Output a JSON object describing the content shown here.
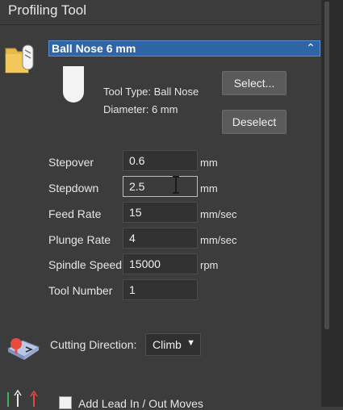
{
  "panel": {
    "title": "Profiling Tool"
  },
  "tool": {
    "name": "Ball Nose 6 mm",
    "type_text": "Tool Type: Ball Nose",
    "diameter_text": "Diameter:  6 mm",
    "select_label": "Select...",
    "deselect_label": "Deselect"
  },
  "params": {
    "stepover": {
      "label": "Stepover",
      "value": "0.6",
      "unit": "mm"
    },
    "stepdown": {
      "label": "Stepdown",
      "value": "2.5",
      "unit": "mm"
    },
    "feed_rate": {
      "label": "Feed Rate",
      "value": "15",
      "unit": "mm/sec"
    },
    "plunge_rate": {
      "label": "Plunge Rate",
      "value": "4",
      "unit": "mm/sec"
    },
    "spindle_speed": {
      "label": "Spindle Speed",
      "value": "15000",
      "unit": "rpm"
    },
    "tool_number": {
      "label": "Tool Number",
      "value": "1"
    }
  },
  "cutting": {
    "label": "Cutting Direction:",
    "selected": "Climb"
  },
  "lead": {
    "label": "Add Lead In / Out Moves"
  },
  "colors": {
    "header_bg": "#2f64a6",
    "panel_bg": "#3c3c3c"
  },
  "icons": [
    "folder-tool-icon",
    "ball-nose-icon",
    "collapse-chevron-icon",
    "cutting-direction-icon",
    "lead-moves-icon",
    "dropdown-arrow-icon"
  ]
}
